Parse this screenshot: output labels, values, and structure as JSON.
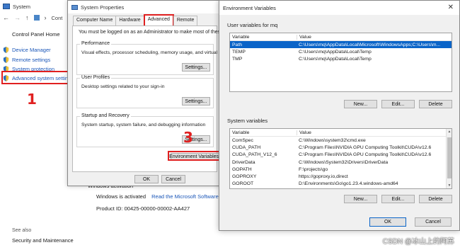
{
  "system": {
    "title": "System",
    "addr_text": "Cont",
    "control_panel_home": "Control Panel Home",
    "left_links": [
      "Device Manager",
      "Remote settings",
      "System protection",
      "Advanced system settings"
    ],
    "see_also": "See also",
    "security_maintenance": "Security and Maintenance",
    "activation_section": "Windows activation",
    "activation_status": "Windows is activated",
    "license_link": "Read the Microsoft Software Licens",
    "product_id": "Product ID: 00425-00000-00002-AA427"
  },
  "annotations": {
    "step1": "1",
    "step2": "2",
    "step3": "3"
  },
  "sysprops": {
    "title": "System Properties",
    "tabs": [
      "Computer Name",
      "Hardware",
      "Advanced",
      "Remote"
    ],
    "active_tab": "Advanced",
    "admin_note": "You must be logged on as an Administrator to make most of these changes.",
    "performance": {
      "title": "Performance",
      "desc": "Visual effects, processor scheduling, memory usage, and virtual memory",
      "button": "Settings..."
    },
    "user_profiles": {
      "title": "User Profiles",
      "desc": "Desktop settings related to your sign-in",
      "button": "Settings..."
    },
    "startup_recovery": {
      "title": "Startup and Recovery",
      "desc": "System startup, system failure, and debugging information",
      "button": "Settings..."
    },
    "env_button": "Environment Variables...",
    "ok_button": "OK",
    "cancel_button": "Cancel"
  },
  "envvars": {
    "title": "Environment Variables",
    "close_glyph": "✕",
    "user_label": "User variables for mq",
    "system_label": "System variables",
    "col_variable": "Variable",
    "col_value": "Value",
    "user_vars": [
      {
        "name": "Path",
        "value": "C:\\Users\\mq\\AppData\\Local\\Microsoft\\WindowsApps;C:\\Users\\m..."
      },
      {
        "name": "TEMP",
        "value": "C:\\Users\\mq\\AppData\\Local\\Temp"
      },
      {
        "name": "TMP",
        "value": "C:\\Users\\mq\\AppData\\Local\\Temp"
      }
    ],
    "system_vars": [
      {
        "name": "ComSpec",
        "value": "C:\\Windows\\system32\\cmd.exe"
      },
      {
        "name": "CUDA_PATH",
        "value": "C:\\Program Files\\NVIDIA GPU Computing Toolkit\\CUDA\\v12.6"
      },
      {
        "name": "CUDA_PATH_V12_6",
        "value": "C:\\Program Files\\NVIDIA GPU Computing Toolkit\\CUDA\\v12.6"
      },
      {
        "name": "DriverData",
        "value": "C:\\Windows\\System32\\Drivers\\DriverData"
      },
      {
        "name": "GOPATH",
        "value": "F:\\projects\\go"
      },
      {
        "name": "GOPROXY",
        "value": "https://goproxy.io,direct"
      },
      {
        "name": "GOROOT",
        "value": "D:\\Environments\\Go\\go1.23.4.windows-amd64"
      }
    ],
    "new_button": "New...",
    "edit_button": "Edit...",
    "delete_button": "Delete",
    "ok_button": "OK",
    "cancel_button": "Cancel"
  },
  "watermark": "CSDN @冰山上的阿苏",
  "colors": {
    "annotation_red": "#e02020",
    "selection_blue": "#0a64c8",
    "link_blue": "#1a56b8"
  }
}
